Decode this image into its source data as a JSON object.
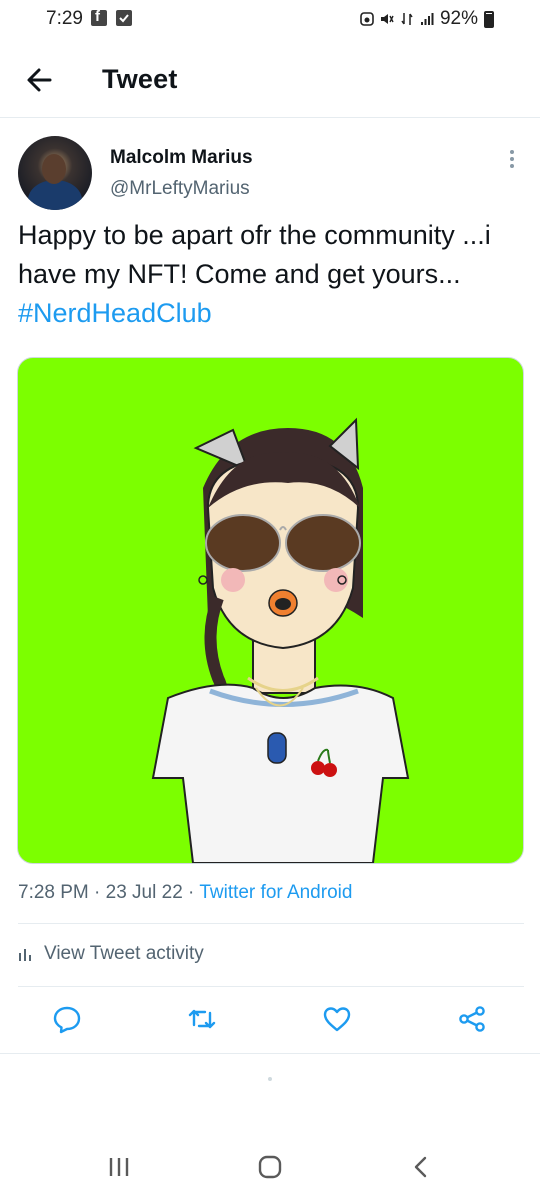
{
  "status_bar": {
    "time": "7:29",
    "battery": "92%",
    "icons": [
      "facebook-icon",
      "check-icon",
      "alarm-icon",
      "mute-icon",
      "data-icon",
      "signal-icon",
      "battery-icon"
    ]
  },
  "header": {
    "title": "Tweet",
    "back_icon": "arrow-left-icon"
  },
  "tweet": {
    "author_name": "Malcolm Marius",
    "author_handle": "@MrLeftyMarius",
    "text_plain": "Happy to be apart ofr the community  ...i have my NFT! Come and get yours... ",
    "hashtag": "#NerdHeadClub",
    "timestamp": "7:28 PM · 23 Jul 22 · ",
    "source": "Twitter for Android",
    "activity_label": "View Tweet activity"
  },
  "actions": [
    "reply-icon",
    "retweet-icon",
    "like-icon",
    "share-icon"
  ],
  "colors": {
    "accent": "#1d9bf0",
    "media_background": "#7cff00",
    "secondary_text": "#536471"
  }
}
